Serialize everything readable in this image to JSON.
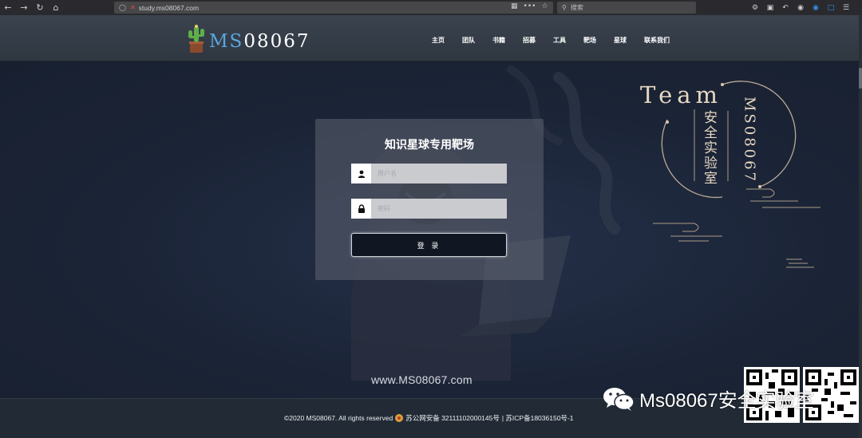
{
  "browser": {
    "url_text": "study.ms08067.com",
    "search_placeholder": "搜索",
    "more_label": "•••"
  },
  "header": {
    "logo_prefix": "MS",
    "logo_suffix": "08067",
    "nav": [
      "主页",
      "团队",
      "书籍",
      "招募",
      "工具",
      "靶场",
      "星球",
      "联系我们"
    ]
  },
  "login": {
    "title": "知识星球专用靶场",
    "username_placeholder": "用户名",
    "password_placeholder": "密码",
    "button_label": "登 录"
  },
  "site_url": "www.MS08067.com",
  "emblem": {
    "team_word": "Team",
    "lab_text": "安全实验室",
    "vertical_brand": "MS08067"
  },
  "footer": {
    "copyright": "©2020 MS08067. All rights reserved",
    "police_record": "苏公网安备 32111102000145号",
    "icp_record": "| 苏ICP备18036150号-1"
  },
  "watermark": {
    "text": "Ms08067安全实验室"
  },
  "colors": {
    "page_bg": "#1b2433",
    "header_bg": "#353d48",
    "accent_blue": "#5aa6e0",
    "emblem_gold": "#e6d7c2",
    "button_bg": "#111722"
  }
}
